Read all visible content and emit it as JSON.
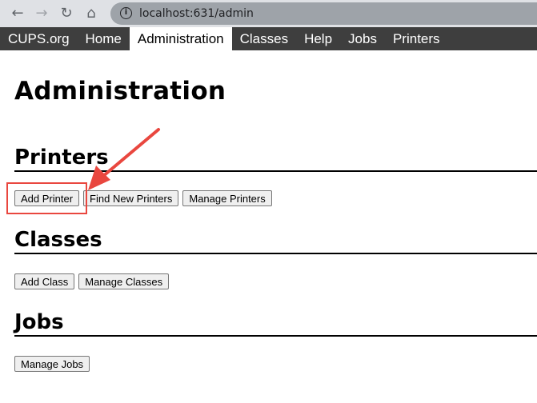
{
  "browser": {
    "url": "localhost:631/admin",
    "icons": [
      "back-arrow-icon",
      "forward-arrow-icon",
      "reload-icon",
      "home-icon",
      "info-icon"
    ]
  },
  "nav": {
    "items": [
      {
        "label": "CUPS.org"
      },
      {
        "label": "Home"
      },
      {
        "label": "Administration",
        "active": true
      },
      {
        "label": "Classes"
      },
      {
        "label": "Help"
      },
      {
        "label": "Jobs"
      },
      {
        "label": "Printers"
      }
    ]
  },
  "page": {
    "title": "Administration",
    "sections": [
      {
        "heading": "Printers",
        "buttons": [
          "Add Printer",
          "Find New Printers",
          "Manage Printers"
        ]
      },
      {
        "heading": "Classes",
        "buttons": [
          "Add Class",
          "Manage Classes"
        ]
      },
      {
        "heading": "Jobs",
        "buttons": [
          "Manage Jobs"
        ]
      }
    ]
  },
  "annotation": {
    "color": "#e9473f",
    "target": "Add Printer"
  }
}
